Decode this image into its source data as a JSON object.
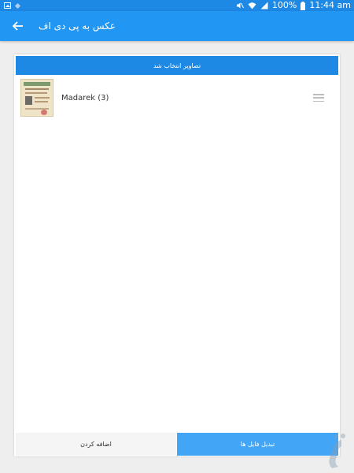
{
  "status_bar": {
    "battery": "100%",
    "time": "11:44 am"
  },
  "app_bar": {
    "title": "عکس به پی دی اف"
  },
  "card": {
    "header_text": "تصاویر انتخاب شد",
    "items": [
      {
        "name": "Madarek (3)"
      }
    ]
  },
  "buttons": {
    "add_label": "اضافه کردن",
    "convert_label": "تبدیل فایل ها"
  },
  "colors": {
    "status_bar": "#1e88e5",
    "app_bar": "#2196f3",
    "accent_button": "#42a5f5"
  },
  "icons": {
    "back": "arrow-left-icon",
    "drag": "drag-handle-icon",
    "mute": "mute-icon",
    "wifi": "wifi-icon",
    "signal": "signal-icon",
    "battery": "battery-icon"
  }
}
